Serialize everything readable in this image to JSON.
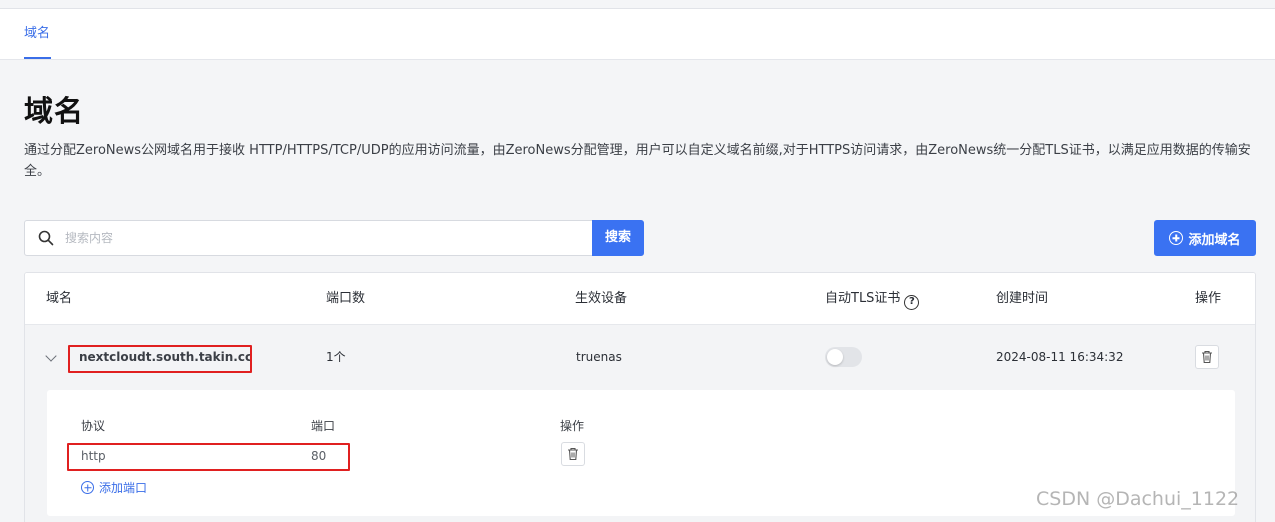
{
  "tabs": [
    {
      "label": "域名"
    }
  ],
  "page": {
    "title": "域名",
    "description": "通过分配ZeroNews公网域名用于接收 HTTP/HTTPS/TCP/UDP的应用访问流量，由ZeroNews分配管理，用户可以自定义域名前缀,对于HTTPS访问请求，由ZeroNews统一分配TLS证书，以满足应用数据的传输安全。"
  },
  "search": {
    "placeholder": "搜索内容",
    "button_label": "搜索"
  },
  "add_domain_label": "添加域名",
  "table": {
    "headers": [
      "域名",
      "端口数",
      "生效设备",
      "自动TLS证书",
      "创建时间",
      "操作"
    ],
    "rows": [
      {
        "domain": "nextcloudt.south.takin.cc",
        "ports": "1个",
        "device": "truenas",
        "auto_tls": false,
        "created": "2024-08-11 16:34:32"
      }
    ]
  },
  "ports_table": {
    "headers": [
      "协议",
      "端口",
      "操作"
    ],
    "rows": [
      {
        "protocol": "http",
        "port": "80"
      }
    ],
    "add_port_label": "添加端口"
  },
  "watermark": "CSDN @Dachui_1122",
  "colors": {
    "accent": "#3a72f2",
    "highlight_box": "#e02020"
  }
}
